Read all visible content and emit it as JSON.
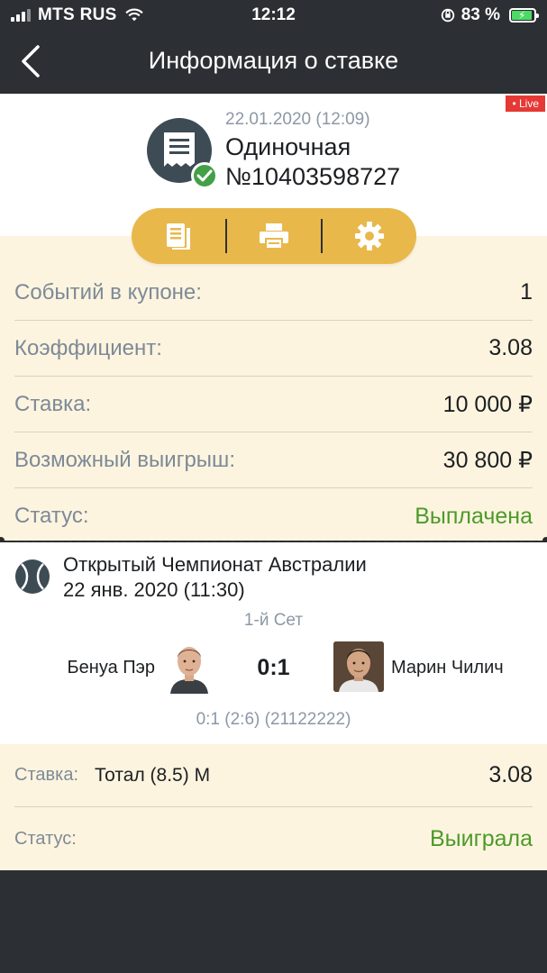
{
  "status_bar": {
    "carrier": "MTS RUS",
    "time": "12:12",
    "battery": "83 %",
    "battery_level": 0.83
  },
  "nav": {
    "title": "Информация о ставке",
    "back_icon": "chevron-left-icon"
  },
  "header": {
    "live_badge": "• Live",
    "date": "22.01.2020 (12:09)",
    "bet_type": "Одиночная",
    "bet_number": "№10403598727"
  },
  "toolbar": {
    "icons": [
      "copy-document-icon",
      "print-icon",
      "settings-gear-icon"
    ]
  },
  "info": {
    "rows": [
      {
        "label": "Событий в купоне:",
        "value": "1"
      },
      {
        "label": "Коэффициент:",
        "value": "3.08"
      },
      {
        "label": "Ставка:",
        "value": "10 000 ₽"
      },
      {
        "label": "Возможный выигрыш:",
        "value": "30 800 ₽"
      },
      {
        "label": "Статус:",
        "value": "Выплачена"
      }
    ]
  },
  "event": {
    "tournament": "Открытый Чемпионат Австралии",
    "date": "22 янв. 2020 (11:30)",
    "period": "1-й Сет",
    "player1": "Бенуа Пэр",
    "player2": "Марин Чилич",
    "score": "0:1",
    "detail": "0:1 (2:6) (21122222)"
  },
  "bet_detail": {
    "stake_label": "Ставка:",
    "market": "Тотал (8.5) М",
    "odds": "3.08",
    "status_label": "Статус:",
    "status_value": "Выиграла"
  },
  "colors": {
    "accent": "#e8b84b",
    "dark": "#2c3034",
    "cream": "#fdf4df",
    "green": "#4c9a2a",
    "muted": "#7d8a97",
    "live": "#e53935"
  }
}
